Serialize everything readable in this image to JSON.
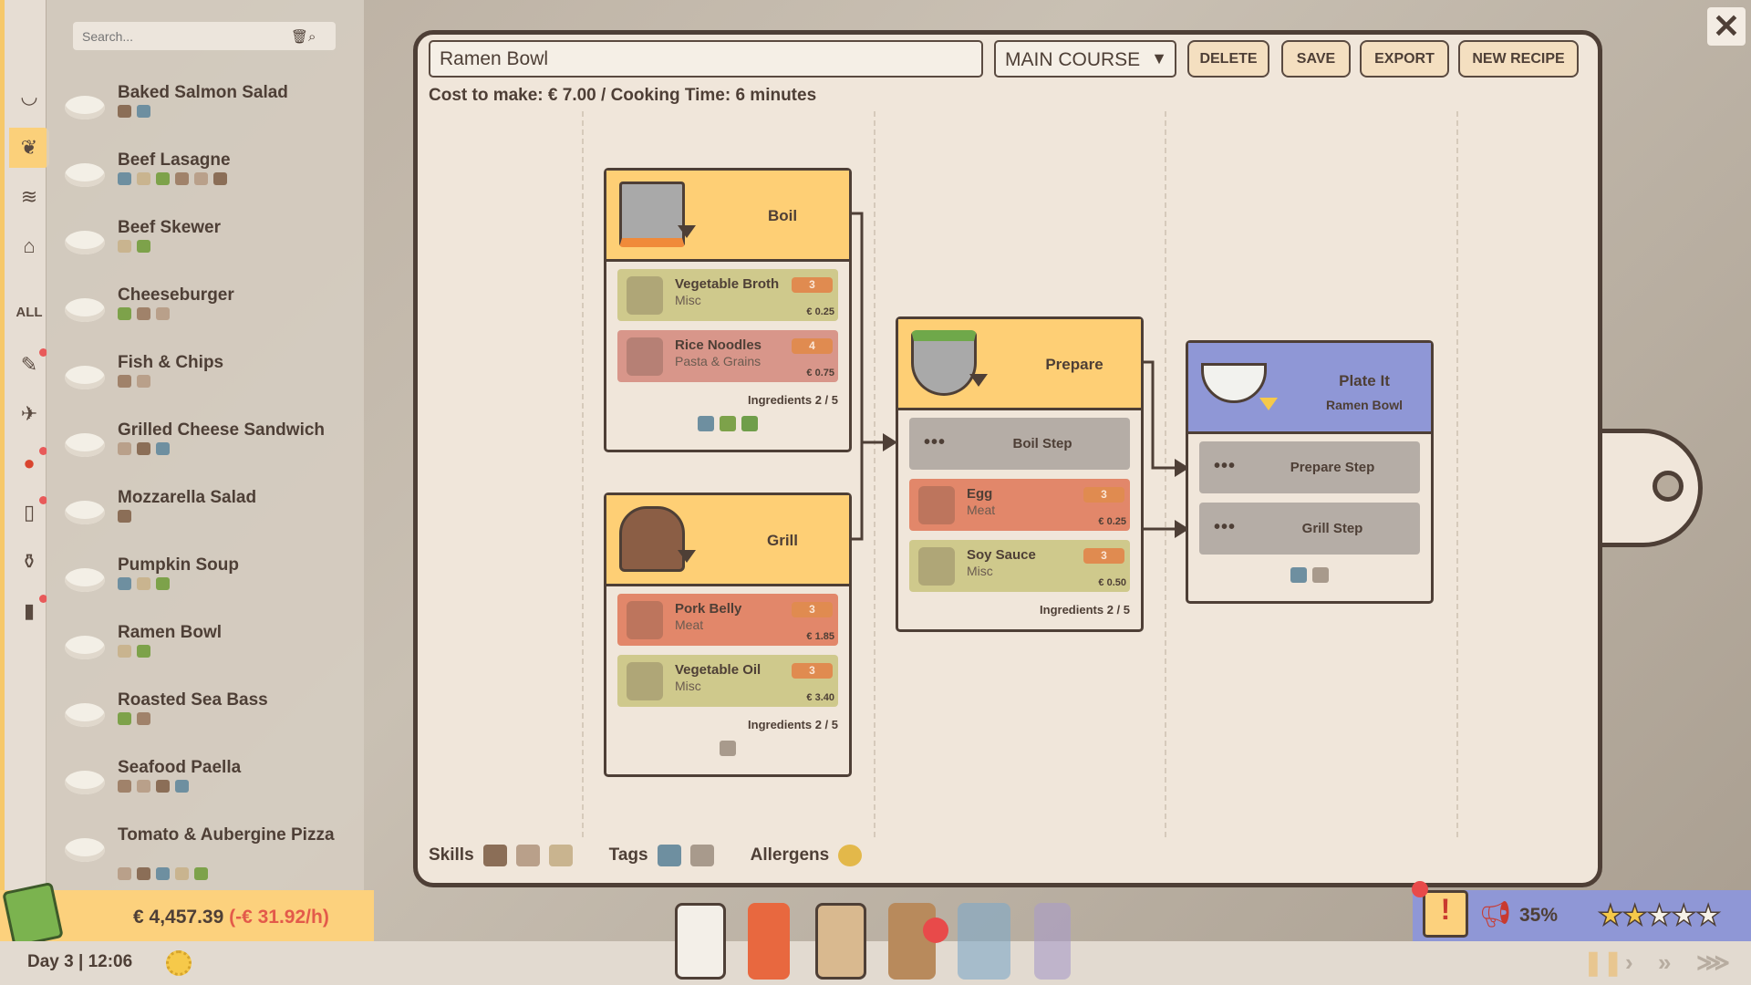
{
  "rail": {
    "all_label": "ALL",
    "items": [
      {
        "icon": "bowl-icon"
      },
      {
        "icon": "salad-icon",
        "active": true
      },
      {
        "icon": "sandwich-icon"
      },
      {
        "icon": "bread-icon"
      },
      {
        "icon": "chicken-leg-icon"
      },
      {
        "icon": "fish-icon"
      },
      {
        "icon": "tomato-icon"
      },
      {
        "icon": "bread-slice-icon"
      },
      {
        "icon": "bottle-icon"
      },
      {
        "icon": "can-icon"
      }
    ]
  },
  "search": {
    "placeholder": "Search..."
  },
  "recipes": [
    {
      "name": "Baked Salmon Salad",
      "tags": 2
    },
    {
      "name": "Beef Lasagne",
      "tags": 6
    },
    {
      "name": "Beef Skewer",
      "tags": 2
    },
    {
      "name": "Cheeseburger",
      "tags": 3
    },
    {
      "name": "Fish & Chips",
      "tags": 2
    },
    {
      "name": "Grilled Cheese Sandwich",
      "tags": 3
    },
    {
      "name": "Mozzarella Salad",
      "tags": 1
    },
    {
      "name": "Pumpkin Soup",
      "tags": 3
    },
    {
      "name": "Ramen Bowl",
      "tags": 2
    },
    {
      "name": "Roasted Sea Bass",
      "tags": 2
    },
    {
      "name": "Seafood Paella",
      "tags": 4
    },
    {
      "name": "Tomato & Aubergine Pizza",
      "tags": 5
    }
  ],
  "editor": {
    "recipe_name": "Ramen Bowl",
    "course": "MAIN COURSE",
    "buttons": {
      "delete": "DELETE",
      "save": "SAVE",
      "export": "EXPORT",
      "new": "NEW RECIPE"
    },
    "cost_line": "Cost to make: € 7.00 / Cooking Time: 6 minutes",
    "nodes": {
      "boil": {
        "title": "Boil",
        "ingredients_count": "Ingredients  2 / 5",
        "rows": [
          {
            "name": "Vegetable Broth",
            "category": "Misc",
            "qty": "3",
            "price": "€ 0.25",
            "color": "#cfc98c"
          },
          {
            "name": "Rice Noodles",
            "category": "Pasta & Grains",
            "qty": "4",
            "price": "€ 0.75",
            "color": "#d8968a"
          }
        ]
      },
      "grill": {
        "title": "Grill",
        "ingredients_count": "Ingredients  2 / 5",
        "rows": [
          {
            "name": "Pork Belly",
            "category": "Meat",
            "qty": "3",
            "price": "€ 1.85",
            "color": "#e2876a"
          },
          {
            "name": "Vegetable Oil",
            "category": "Misc",
            "qty": "3",
            "price": "€ 3.40",
            "color": "#cfc98c"
          }
        ]
      },
      "prepare": {
        "title": "Prepare",
        "step": "Boil Step",
        "ingredients_count": "Ingredients  2 / 5",
        "rows": [
          {
            "name": "Egg",
            "category": "Meat",
            "qty": "3",
            "price": "€ 0.25",
            "color": "#e2876a"
          },
          {
            "name": "Soy Sauce",
            "category": "Misc",
            "qty": "3",
            "price": "€ 0.50",
            "color": "#cfc98c"
          }
        ]
      },
      "plate": {
        "title": "Plate It",
        "subtitle": "Ramen Bowl",
        "steps": [
          "Prepare Step",
          "Grill Step"
        ]
      }
    },
    "footer": {
      "skills": "Skills",
      "tags": "Tags",
      "allergens": "Allergens"
    }
  },
  "status": {
    "money": "€ 4,457.39",
    "rate": "(-€ 31.92/h)",
    "day": "Day 3 | 12:06",
    "popularity": "35%",
    "rating": 2,
    "rating_max": 5
  },
  "colors": {
    "accent": "#fecf75",
    "plate": "#8f97d6",
    "border": "#4e3f36",
    "background": "#f0e6da"
  }
}
